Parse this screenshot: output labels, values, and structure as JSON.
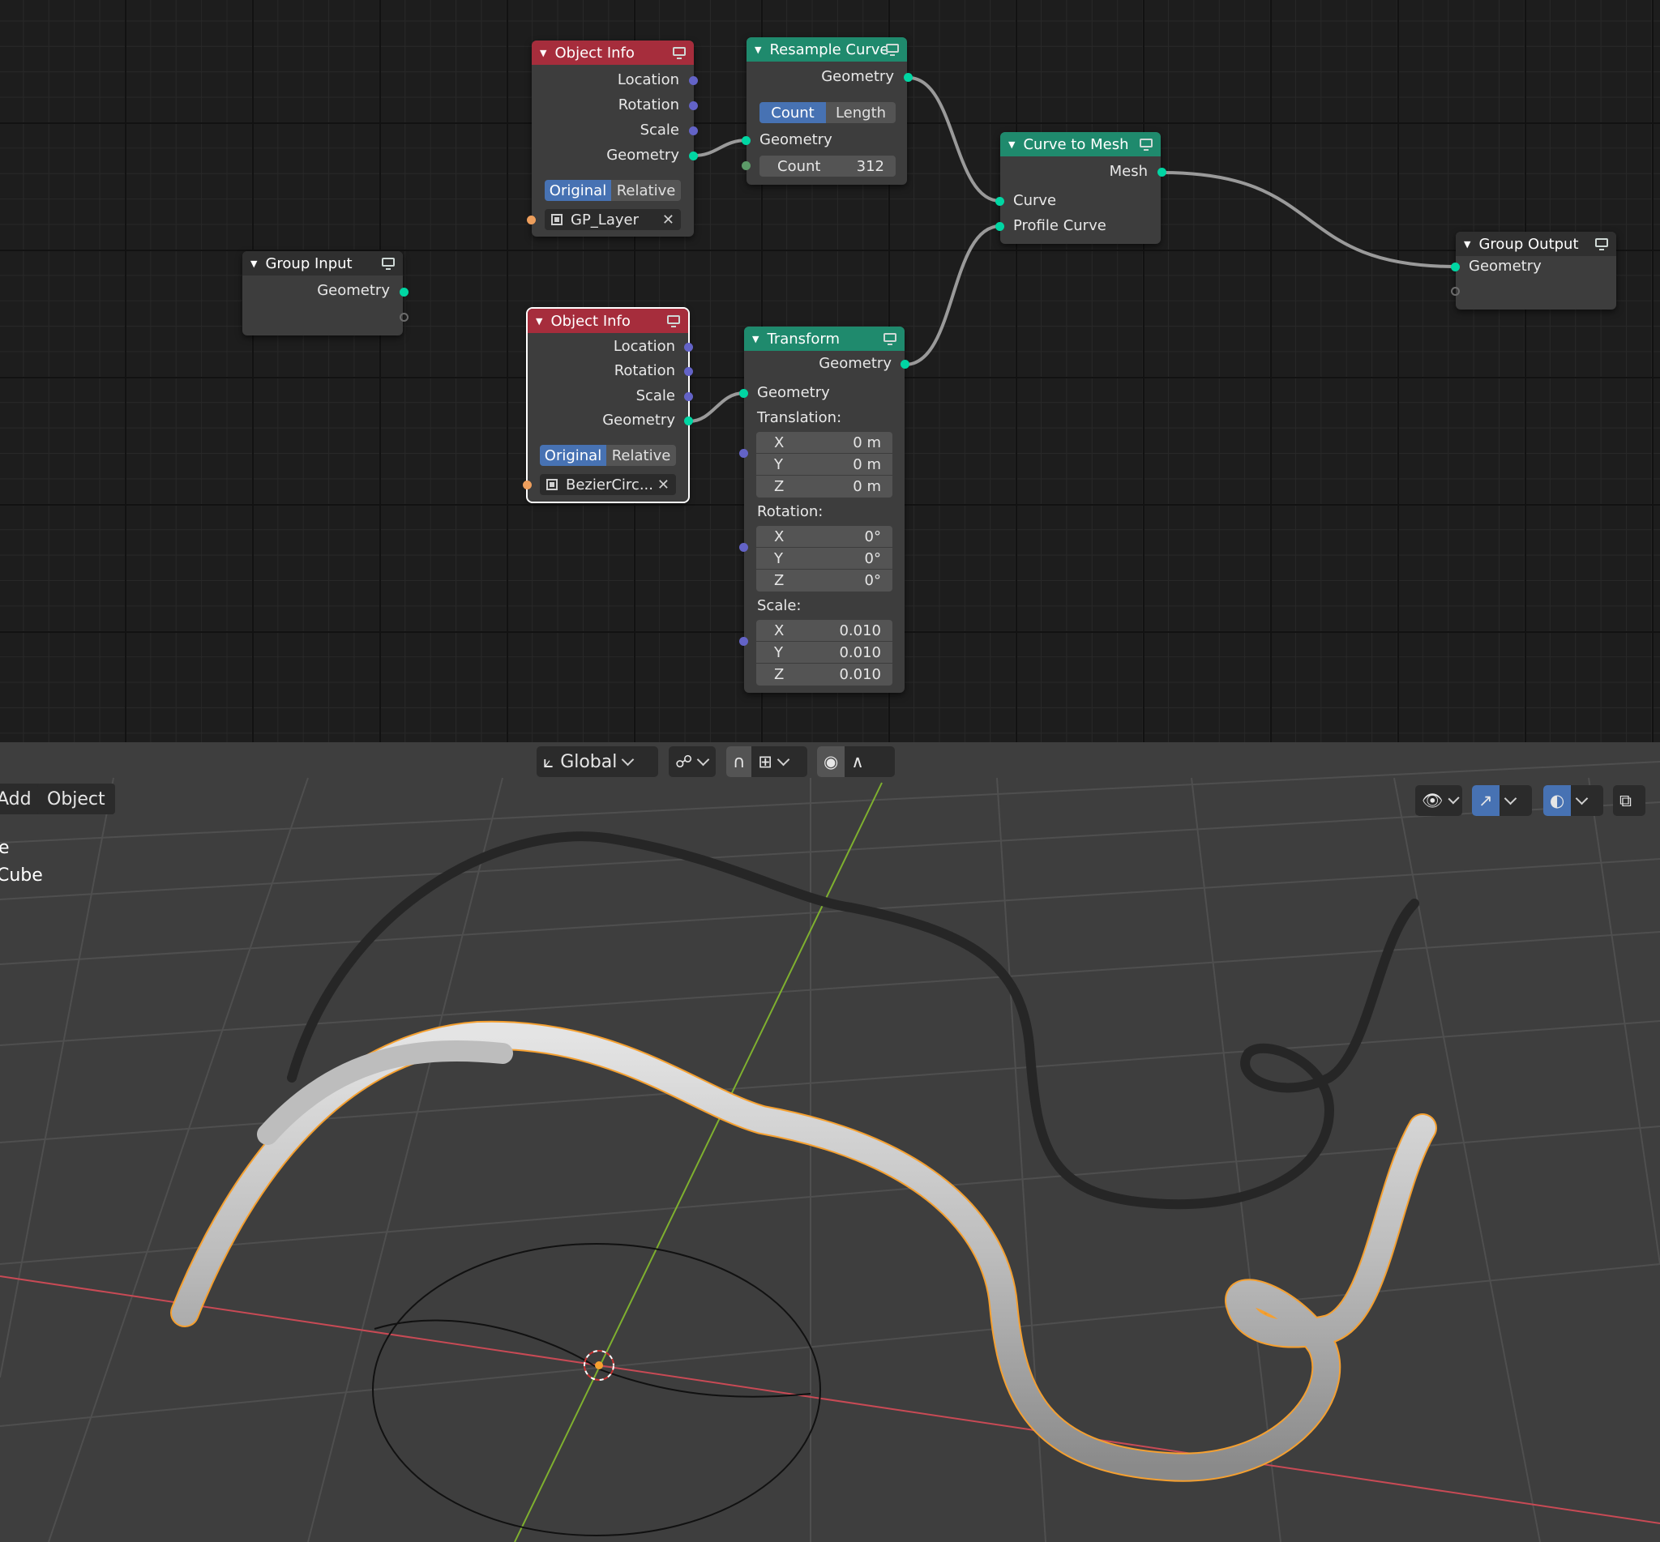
{
  "nodes": {
    "object_info_1": {
      "title": "Object Info",
      "outputs": [
        "Location",
        "Rotation",
        "Scale",
        "Geometry"
      ],
      "toggle": [
        "Original",
        "Relative"
      ],
      "object": "GP_Layer"
    },
    "object_info_2": {
      "title": "Object Info",
      "outputs": [
        "Location",
        "Rotation",
        "Scale",
        "Geometry"
      ],
      "toggle": [
        "Original",
        "Relative"
      ],
      "object": "BezierCirc..."
    },
    "resample_curve": {
      "title": "Resample Curve",
      "output": "Geometry",
      "modes": [
        "Count",
        "Length"
      ],
      "input": "Geometry",
      "count_label": "Count",
      "count_value": "312"
    },
    "curve_to_mesh": {
      "title": "Curve to Mesh",
      "output": "Mesh",
      "inputs": [
        "Curve",
        "Profile Curve"
      ]
    },
    "group_input": {
      "title": "Group Input",
      "output": "Geometry"
    },
    "group_output": {
      "title": "Group Output",
      "input": "Geometry"
    },
    "transform": {
      "title": "Transform",
      "output": "Geometry",
      "input": "Geometry",
      "translation_label": "Translation:",
      "translation": [
        {
          "axis": "X",
          "value": "0 m"
        },
        {
          "axis": "Y",
          "value": "0 m"
        },
        {
          "axis": "Z",
          "value": "0 m"
        }
      ],
      "rotation_label": "Rotation:",
      "rotation": [
        {
          "axis": "X",
          "value": "0°"
        },
        {
          "axis": "Y",
          "value": "0°"
        },
        {
          "axis": "Z",
          "value": "0°"
        }
      ],
      "scale_label": "Scale:",
      "scale": [
        {
          "axis": "X",
          "value": "0.010"
        },
        {
          "axis": "Y",
          "value": "0.010"
        },
        {
          "axis": "Z",
          "value": "0.010"
        }
      ]
    }
  },
  "viewport": {
    "orientation": "Global",
    "menu": [
      "Add",
      "Object"
    ],
    "outliner_lines": [
      "e",
      "Cube"
    ]
  },
  "colors": {
    "node_header_red": "#a62d3c",
    "node_header_green": "#1f8a6d",
    "socket_geometry": "#00d6a3",
    "socket_vector": "#6363c7",
    "socket_object": "#ed9e5c",
    "selection_outline": "#f5a030",
    "axis_x": "#c84a55",
    "axis_y": "#7fb02f",
    "active_button": "#4772b3"
  }
}
